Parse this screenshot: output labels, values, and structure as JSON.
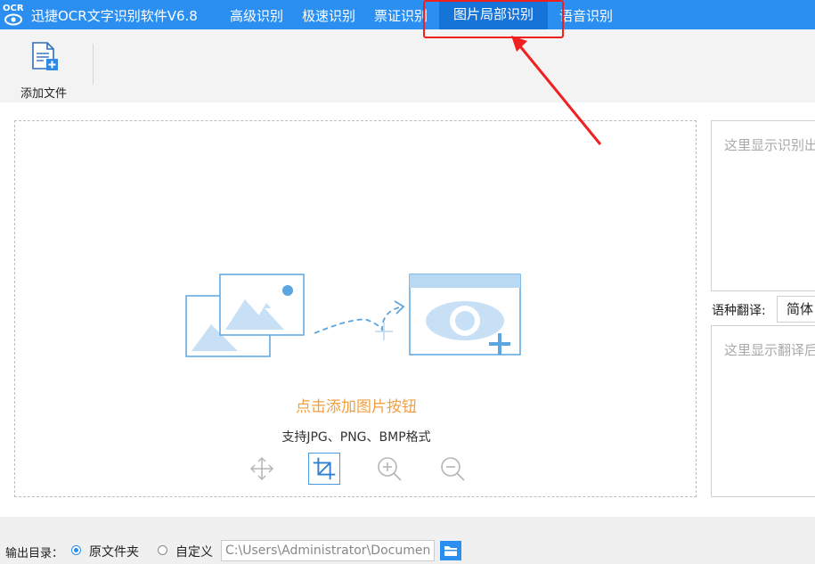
{
  "titlebar": {
    "logo_text": "OCR",
    "app_title": "迅捷OCR文字识别软件V6.8",
    "menu": [
      {
        "label": "高级识别",
        "active": false
      },
      {
        "label": "极速识别",
        "active": false
      },
      {
        "label": "票证识别",
        "active": false
      },
      {
        "label": "图片局部识别",
        "active": true
      },
      {
        "label": "语音识别",
        "active": false
      }
    ]
  },
  "toolbar": {
    "add_file_label": "添加文件",
    "add_file_icon": "add-document-icon"
  },
  "dropzone": {
    "hint": "点击添加图片按钮",
    "formats": "支持JPG、PNG、BMP格式",
    "tools": [
      "move-icon",
      "crop-icon",
      "zoom-in-icon",
      "zoom-out-icon"
    ],
    "active_tool": "crop-icon"
  },
  "right_panel": {
    "result_placeholder": "这里显示识别出",
    "translate_label": "语种翻译:",
    "language_selected": "简体",
    "translate_placeholder": "这里显示翻译后"
  },
  "output": {
    "label": "输出目录：",
    "options": [
      "原文件夹",
      "自定义"
    ],
    "selected": "原文件夹",
    "path_value": "C:\\Users\\Administrator\\Documents"
  },
  "colors": {
    "titlebar": "#2a8ff0",
    "active_tab": "#1673d8",
    "hint": "#f0a040",
    "annotation": "#f02020",
    "illustration": "#5aa6e0"
  }
}
